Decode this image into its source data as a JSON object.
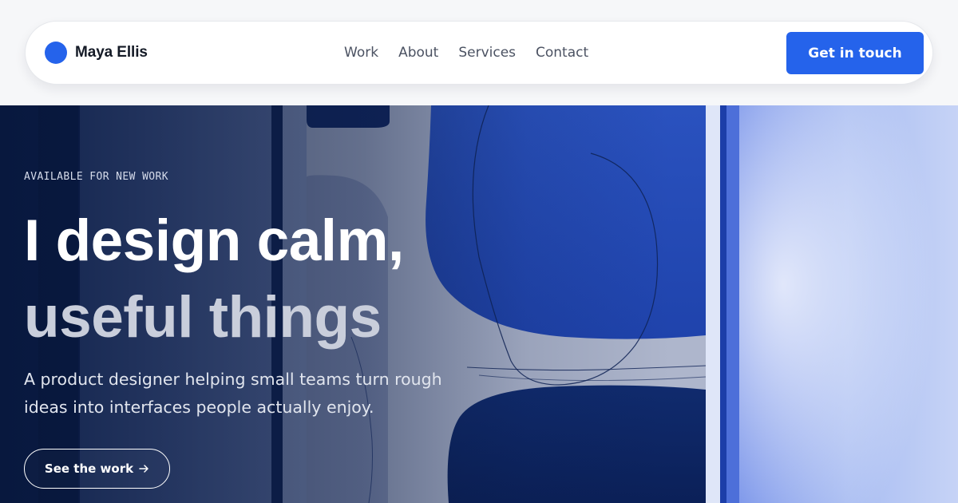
{
  "header": {
    "brand_name": "Maya Ellis",
    "nav": [
      {
        "label": "Work"
      },
      {
        "label": "About"
      },
      {
        "label": "Services"
      },
      {
        "label": "Contact"
      }
    ],
    "cta_label": "Get in touch"
  },
  "hero": {
    "eyebrow": "AVAILABLE FOR NEW WORK",
    "headline_line1": "I design calm,",
    "headline_line2": "useful things",
    "subtext_line1": "A product designer helping small teams turn rough",
    "subtext_line2": "ideas into interfaces people actually enjoy.",
    "button_label": "See the work",
    "button_icon": "arrow-right-icon"
  },
  "colors": {
    "accent": "#2563eb",
    "page_background": "#f6f7f9",
    "headline_primary": "#ffffff",
    "headline_secondary": "#c9cedb"
  }
}
